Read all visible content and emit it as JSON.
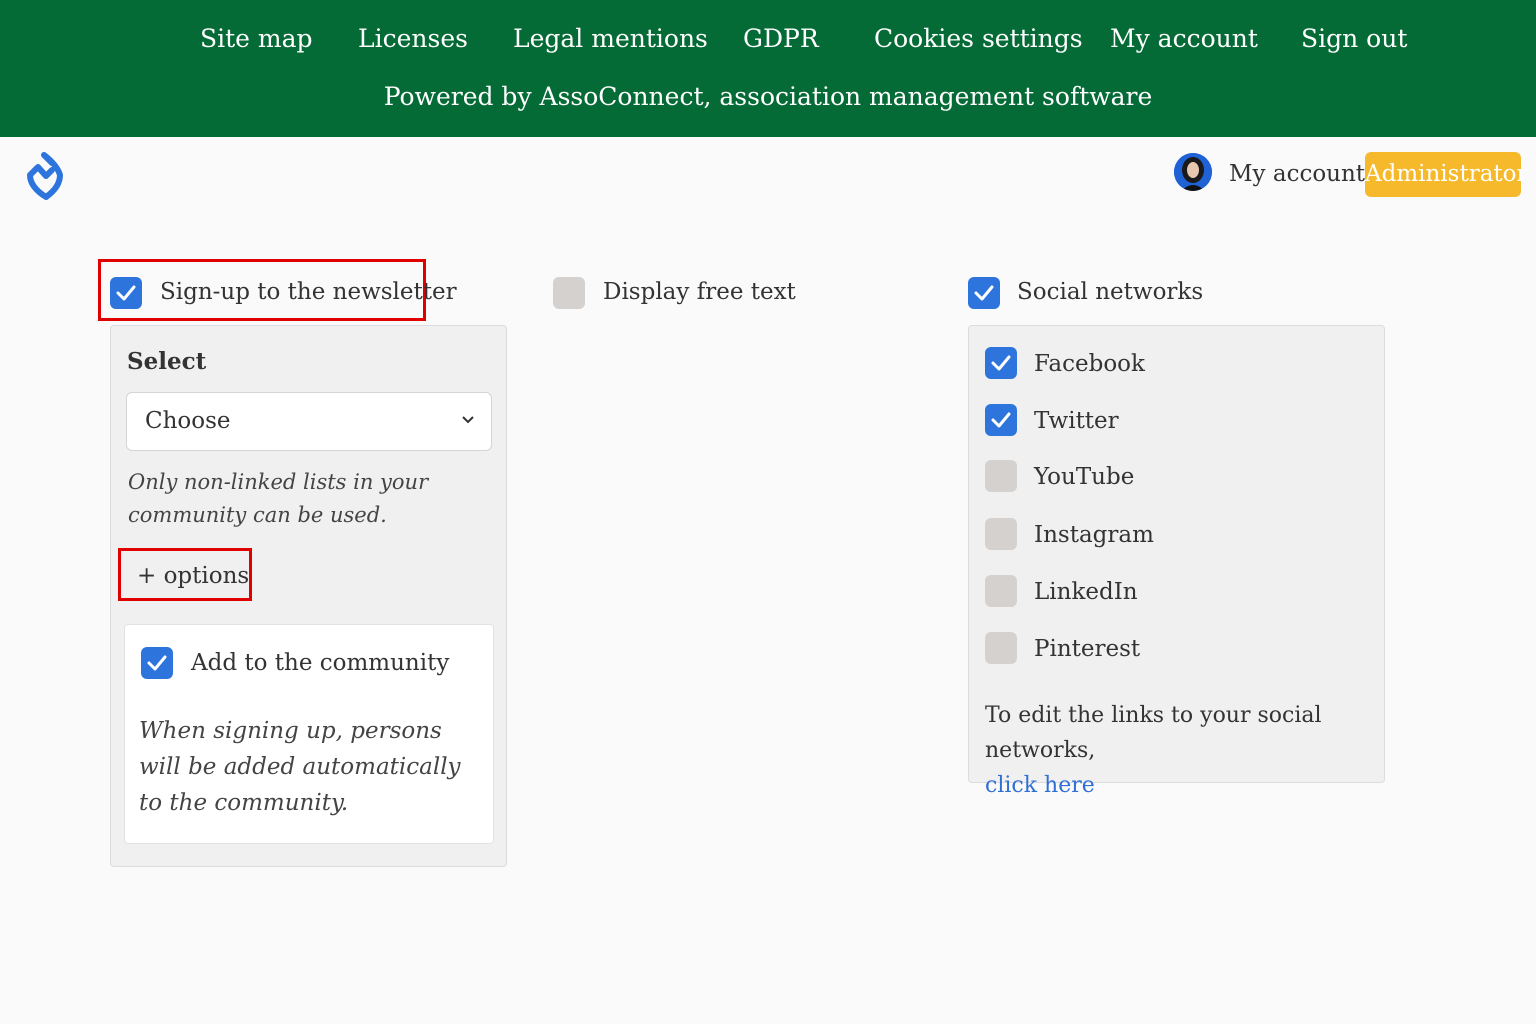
{
  "footer": {
    "links": [
      "Site map",
      "Licenses",
      "Legal mentions",
      "GDPR",
      "Cookies settings",
      "My account",
      "Sign out"
    ],
    "powered_by": "Powered by AssoConnect, association management software"
  },
  "header": {
    "logo_icon": "assoconnect-logo-icon",
    "account_label": "My account",
    "role_button": "Administrator"
  },
  "colors": {
    "footer_bg": "#046b36",
    "accent_blue": "#2d74dc",
    "admin_yellow": "#f6b92b",
    "highlight_red": "#e00000"
  },
  "newsletter": {
    "label": "Sign-up to the newsletter",
    "checked": true,
    "select_title": "Select",
    "select_value": "Choose",
    "hint": "Only non-linked lists in your community can be used.",
    "options_link": "+ options",
    "add_community": {
      "label": "Add to the community",
      "checked": true,
      "description": "When signing up, persons will be added automatically to the community."
    }
  },
  "free_text": {
    "label": "Display free text",
    "checked": false
  },
  "social": {
    "label": "Social networks",
    "checked": true,
    "networks": [
      {
        "name": "Facebook",
        "checked": true
      },
      {
        "name": "Twitter",
        "checked": true
      },
      {
        "name": "YouTube",
        "checked": false
      },
      {
        "name": "Instagram",
        "checked": false
      },
      {
        "name": "LinkedIn",
        "checked": false
      },
      {
        "name": "Pinterest",
        "checked": false
      }
    ],
    "edit_note": "To edit the links to your social networks,",
    "edit_link": "click here"
  }
}
